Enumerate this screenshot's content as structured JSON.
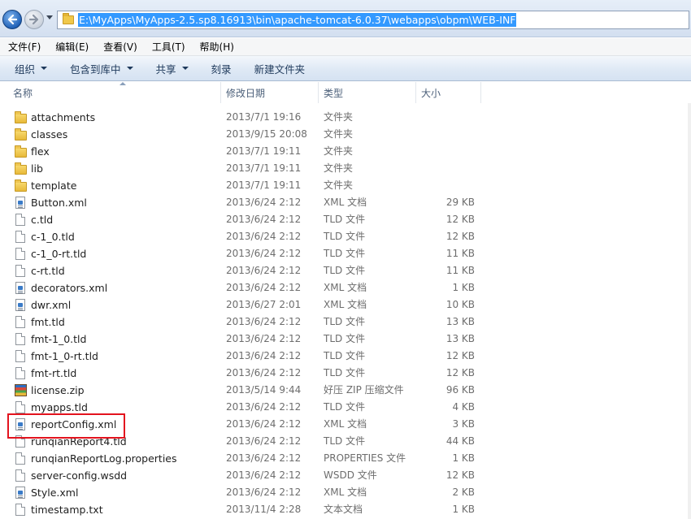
{
  "address_bar": {
    "path": "E:\\MyApps\\MyApps-2.5.sp8.16913\\bin\\apache-tomcat-6.0.37\\webapps\\obpm\\WEB-INF"
  },
  "menu": [
    "文件(F)",
    "编辑(E)",
    "查看(V)",
    "工具(T)",
    "帮助(H)"
  ],
  "toolbar": [
    {
      "label": "组织",
      "dropdown": true
    },
    {
      "label": "包含到库中",
      "dropdown": true
    },
    {
      "label": "共享",
      "dropdown": true
    },
    {
      "label": "刻录",
      "dropdown": false
    },
    {
      "label": "新建文件夹",
      "dropdown": false
    }
  ],
  "columns": {
    "name": "名称",
    "date": "修改日期",
    "type": "类型",
    "size": "大小"
  },
  "files": [
    {
      "name": "attachments",
      "date": "2013/7/1 19:16",
      "type": "文件夹",
      "size": "",
      "icon": "folder-icon"
    },
    {
      "name": "classes",
      "date": "2013/9/15 20:08",
      "type": "文件夹",
      "size": "",
      "icon": "folder-icon"
    },
    {
      "name": "flex",
      "date": "2013/7/1 19:11",
      "type": "文件夹",
      "size": "",
      "icon": "folder-icon"
    },
    {
      "name": "lib",
      "date": "2013/7/1 19:11",
      "type": "文件夹",
      "size": "",
      "icon": "folder-icon"
    },
    {
      "name": "template",
      "date": "2013/7/1 19:11",
      "type": "文件夹",
      "size": "",
      "icon": "folder-icon"
    },
    {
      "name": "Button.xml",
      "date": "2013/6/24 2:12",
      "type": "XML 文档",
      "size": "29 KB",
      "icon": "xml-file-icon"
    },
    {
      "name": "c.tld",
      "date": "2013/6/24 2:12",
      "type": "TLD 文件",
      "size": "12 KB",
      "icon": "file-icon"
    },
    {
      "name": "c-1_0.tld",
      "date": "2013/6/24 2:12",
      "type": "TLD 文件",
      "size": "12 KB",
      "icon": "file-icon"
    },
    {
      "name": "c-1_0-rt.tld",
      "date": "2013/6/24 2:12",
      "type": "TLD 文件",
      "size": "11 KB",
      "icon": "file-icon"
    },
    {
      "name": "c-rt.tld",
      "date": "2013/6/24 2:12",
      "type": "TLD 文件",
      "size": "11 KB",
      "icon": "file-icon"
    },
    {
      "name": "decorators.xml",
      "date": "2013/6/24 2:12",
      "type": "XML 文档",
      "size": "1 KB",
      "icon": "xml-file-icon"
    },
    {
      "name": "dwr.xml",
      "date": "2013/6/27 2:01",
      "type": "XML 文档",
      "size": "10 KB",
      "icon": "xml-file-icon"
    },
    {
      "name": "fmt.tld",
      "date": "2013/6/24 2:12",
      "type": "TLD 文件",
      "size": "13 KB",
      "icon": "file-icon"
    },
    {
      "name": "fmt-1_0.tld",
      "date": "2013/6/24 2:12",
      "type": "TLD 文件",
      "size": "13 KB",
      "icon": "file-icon"
    },
    {
      "name": "fmt-1_0-rt.tld",
      "date": "2013/6/24 2:12",
      "type": "TLD 文件",
      "size": "12 KB",
      "icon": "file-icon"
    },
    {
      "name": "fmt-rt.tld",
      "date": "2013/6/24 2:12",
      "type": "TLD 文件",
      "size": "12 KB",
      "icon": "file-icon"
    },
    {
      "name": "license.zip",
      "date": "2013/5/14 9:44",
      "type": "好压 ZIP 压缩文件",
      "size": "96 KB",
      "icon": "zip-file-icon"
    },
    {
      "name": "myapps.tld",
      "date": "2013/6/24 2:12",
      "type": "TLD 文件",
      "size": "4 KB",
      "icon": "file-icon"
    },
    {
      "name": "reportConfig.xml",
      "date": "2013/6/24 2:12",
      "type": "XML 文档",
      "size": "3 KB",
      "icon": "xml-file-icon"
    },
    {
      "name": "runqianReport4.tld",
      "date": "2013/6/24 2:12",
      "type": "TLD 文件",
      "size": "44 KB",
      "icon": "file-icon"
    },
    {
      "name": "runqianReportLog.properties",
      "date": "2013/6/24 2:12",
      "type": "PROPERTIES 文件",
      "size": "1 KB",
      "icon": "file-icon"
    },
    {
      "name": "server-config.wsdd",
      "date": "2013/6/24 2:12",
      "type": "WSDD 文件",
      "size": "12 KB",
      "icon": "file-icon"
    },
    {
      "name": "Style.xml",
      "date": "2013/6/24 2:12",
      "type": "XML 文档",
      "size": "2 KB",
      "icon": "xml-file-icon"
    },
    {
      "name": "timestamp.txt",
      "date": "2013/11/4 2:28",
      "type": "文本文档",
      "size": "1 KB",
      "icon": "text-file-icon"
    }
  ],
  "colors": {
    "highlight_box": "#e3131e",
    "address_selection": "#3399ff"
  }
}
